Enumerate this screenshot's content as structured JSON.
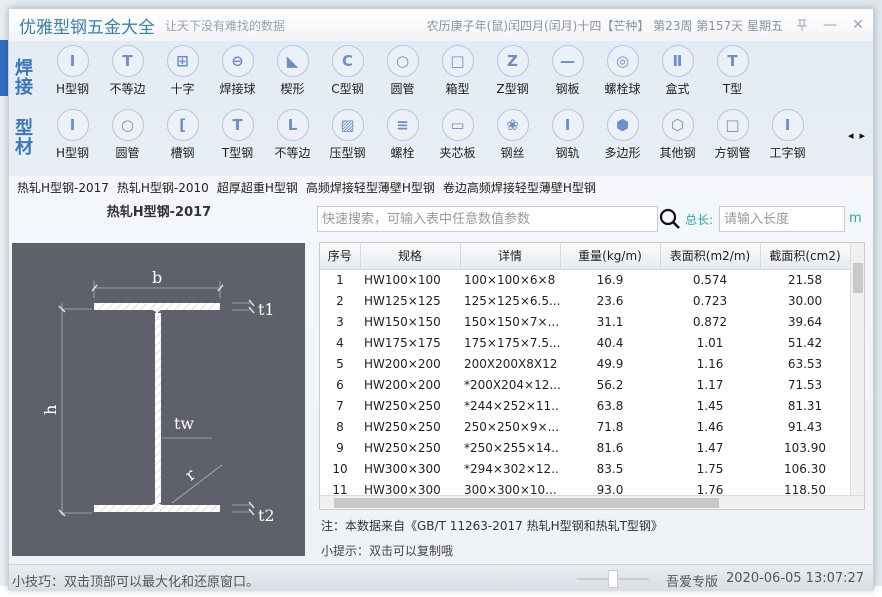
{
  "window": {
    "title": "优雅型钢五金大全",
    "slogan": "让天下没有难找的数据",
    "lunar_date": "农历庚子年(鼠)闰四月(闰月)十四【芒种】 第23周 第157天 星期五",
    "pin_icon": "⊥",
    "minimize_icon": "—",
    "close_icon": "✕"
  },
  "toolbar": {
    "row1_label": "焊接",
    "row2_label": "型材",
    "row1": [
      {
        "label": "H型钢",
        "icon": "H-beam",
        "glyph": "I"
      },
      {
        "label": "不等边",
        "icon": "T-beam",
        "glyph": "T"
      },
      {
        "label": "十字",
        "icon": "cross",
        "glyph": "⊞"
      },
      {
        "label": "焊接球",
        "icon": "weld-ball",
        "glyph": "⊖"
      },
      {
        "label": "楔形",
        "icon": "wedge",
        "glyph": "◣"
      },
      {
        "label": "C型钢",
        "icon": "c-channel",
        "glyph": "C"
      },
      {
        "label": "圆管",
        "icon": "round-pipe",
        "glyph": "○"
      },
      {
        "label": "箱型",
        "icon": "box",
        "glyph": "□"
      },
      {
        "label": "Z型钢",
        "icon": "z-steel",
        "glyph": "Z"
      },
      {
        "label": "钢板",
        "icon": "plate",
        "glyph": "—"
      },
      {
        "label": "螺栓球",
        "icon": "bolt-ball",
        "glyph": "◎"
      },
      {
        "label": "盒式",
        "icon": "box-type",
        "glyph": "Ⅱ"
      },
      {
        "label": "T型",
        "icon": "t-type",
        "glyph": "T"
      }
    ],
    "row2": [
      {
        "label": "H型钢",
        "icon": "H-beam",
        "glyph": "I"
      },
      {
        "label": "圆管",
        "icon": "round-pipe",
        "glyph": "○"
      },
      {
        "label": "槽钢",
        "icon": "channel",
        "glyph": "["
      },
      {
        "label": "T型钢",
        "icon": "t-steel",
        "glyph": "T"
      },
      {
        "label": "不等边",
        "icon": "angle",
        "glyph": "L"
      },
      {
        "label": "压型钢",
        "icon": "deck",
        "glyph": "▨"
      },
      {
        "label": "螺栓",
        "icon": "bolt",
        "glyph": "≡"
      },
      {
        "label": "夹芯板",
        "icon": "sandwich-panel",
        "glyph": "▭"
      },
      {
        "label": "钢丝",
        "icon": "wire",
        "glyph": "❀"
      },
      {
        "label": "钢轨",
        "icon": "rail",
        "glyph": "I"
      },
      {
        "label": "多边形",
        "icon": "polygon",
        "glyph": "⬢"
      },
      {
        "label": "其他钢",
        "icon": "other",
        "glyph": "⬡"
      },
      {
        "label": "方钢管",
        "icon": "square-tube",
        "glyph": "□"
      },
      {
        "label": "工字钢",
        "icon": "i-beam",
        "glyph": "I"
      }
    ],
    "scroll_left": "◂",
    "scroll_right": "▸"
  },
  "subtabs": [
    "热轧H型钢-2017",
    "热轧H型钢-2010",
    "超厚超重H型钢",
    "高频焊接轻型薄壁H型钢",
    "卷边高频焊接轻型薄壁H型钢"
  ],
  "section_title": "热轧H型钢-2017",
  "diagram_labels": {
    "b": "b",
    "h": "h",
    "t1": "t1",
    "t2": "t2",
    "tw": "tw",
    "r": "r"
  },
  "search": {
    "placeholder": "快速搜索，可输入表中任意数值参数",
    "length_label": "总长:",
    "length_placeholder": "请输入长度",
    "unit": "m"
  },
  "table": {
    "columns": [
      "序号",
      "规格",
      "详情",
      "重量(kg/m)",
      "表面积(m2/m)",
      "截面积(cm2)"
    ],
    "rows": [
      [
        "1",
        "HW100×100",
        "100×100×6×8",
        "16.9",
        "0.574",
        "21.58"
      ],
      [
        "2",
        "HW125×125",
        "125×125×6.5...",
        "23.6",
        "0.723",
        "30.00"
      ],
      [
        "3",
        "HW150×150",
        "150×150×7×...",
        "31.1",
        "0.872",
        "39.64"
      ],
      [
        "4",
        "HW175×175",
        "175×175×7.5...",
        "40.4",
        "1.01",
        "51.42"
      ],
      [
        "5",
        "HW200×200",
        "200X200X8X12",
        "49.9",
        "1.16",
        "63.53"
      ],
      [
        "6",
        "HW200×200",
        "*200X204×12...",
        "56.2",
        "1.17",
        "71.53"
      ],
      [
        "7",
        "HW250×250",
        "*244×252×11...",
        "63.8",
        "1.45",
        "81.31"
      ],
      [
        "8",
        "HW250×250",
        "250×250×9×...",
        "71.8",
        "1.46",
        "91.43"
      ],
      [
        "9",
        "HW250×250",
        "*250×255×14...",
        "81.6",
        "1.47",
        "103.90"
      ],
      [
        "10",
        "HW300×300",
        "*294×302×12...",
        "83.5",
        "1.75",
        "106.30"
      ],
      [
        "11",
        "HW300×300",
        "300×300×10...",
        "93.0",
        "1.76",
        "118.50"
      ]
    ]
  },
  "note": "注：本数据来自《GB/T  11263-2017 热轧H型钢和热轧T型钢》",
  "tip": "小提示：双击可以复制哦",
  "statusbar": {
    "tip": "小技巧：双击顶部可以最大化和还原窗口。",
    "edition": "吾爱专版",
    "datetime": "2020-06-05 13:07:27"
  }
}
